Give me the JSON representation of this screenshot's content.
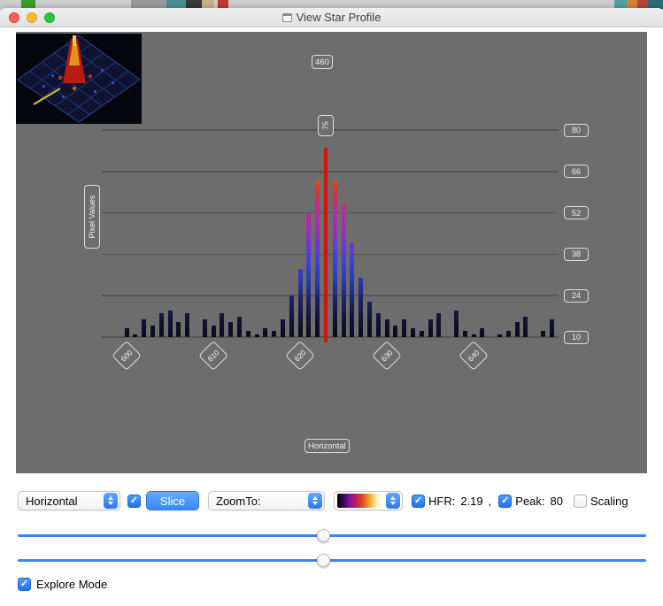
{
  "window": {
    "title": "View Star Profile"
  },
  "chart_data": {
    "type": "bar",
    "xlabel": "Horizontal",
    "ylabel": "Pixel Values",
    "x_ticks": [
      600,
      610,
      620,
      630,
      640
    ],
    "y_ticks": [
      80,
      66,
      52,
      38,
      24,
      10
    ],
    "ylim": [
      10,
      80
    ],
    "grid": true,
    "top_badge": "460",
    "slice_badge": "75",
    "peak_x": 623,
    "slice_color": "#cc1410",
    "bar_colormap": [
      "#0a0a1c",
      "#141436",
      "#1d2468",
      "#2a3ab8",
      "#3d42d8",
      "#7436d2",
      "#a92db4",
      "#c92a82",
      "#d83a28",
      "#e08a22",
      "#d42418",
      "#c81410"
    ],
    "bars": [
      [
        600,
        13
      ],
      [
        601,
        11
      ],
      [
        602,
        16
      ],
      [
        603,
        14
      ],
      [
        604,
        18
      ],
      [
        605,
        19
      ],
      [
        606,
        15
      ],
      [
        607,
        18
      ],
      [
        609,
        16
      ],
      [
        610,
        14
      ],
      [
        611,
        18
      ],
      [
        612,
        15
      ],
      [
        613,
        17
      ],
      [
        614,
        12
      ],
      [
        615,
        11
      ],
      [
        616,
        13
      ],
      [
        617,
        12
      ],
      [
        618,
        16
      ],
      [
        619,
        24
      ],
      [
        620,
        33
      ],
      [
        621,
        52
      ],
      [
        622,
        63
      ],
      [
        623,
        74
      ],
      [
        624,
        63
      ],
      [
        625,
        55
      ],
      [
        626,
        42
      ],
      [
        627,
        30
      ],
      [
        628,
        22
      ],
      [
        629,
        18
      ],
      [
        630,
        16
      ],
      [
        631,
        14
      ],
      [
        632,
        16
      ],
      [
        633,
        13
      ],
      [
        634,
        12
      ],
      [
        635,
        16
      ],
      [
        636,
        18
      ],
      [
        638,
        19
      ],
      [
        639,
        12
      ],
      [
        640,
        11
      ],
      [
        641,
        13
      ],
      [
        643,
        11
      ],
      [
        644,
        12
      ],
      [
        645,
        15
      ],
      [
        646,
        17
      ],
      [
        648,
        12
      ],
      [
        649,
        16
      ]
    ]
  },
  "controls": {
    "direction_select": "Horizontal",
    "slice_button": "Slice",
    "zoom_select": "ZoomTo:",
    "colormap_swatch": [
      "#000000",
      "#38095f",
      "#8c1598",
      "#c91e4a",
      "#e2581e",
      "#efae2e",
      "#f8f0c0",
      "#ffffff"
    ],
    "hfr_label": "HFR:",
    "hfr_value": "2.19",
    "separator": ",",
    "peak_label": "Peak:",
    "peak_value": "80",
    "scaling_label": "Scaling",
    "explore_label": "Explore Mode",
    "checkboxes": {
      "slice_enabled": true,
      "hfr": true,
      "peak": true,
      "scaling": false,
      "explore": true
    }
  }
}
